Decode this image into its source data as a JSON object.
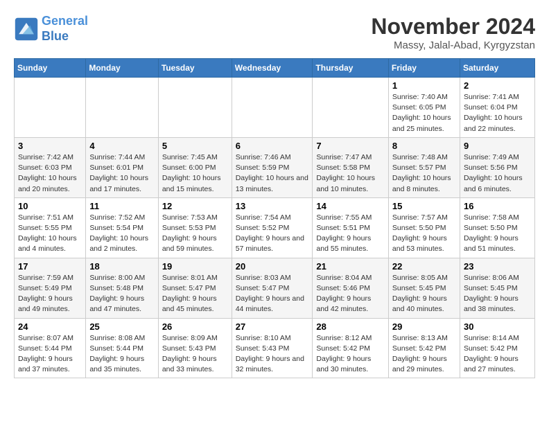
{
  "header": {
    "logo_line1": "General",
    "logo_line2": "Blue",
    "month": "November 2024",
    "location": "Massy, Jalal-Abad, Kyrgyzstan"
  },
  "weekdays": [
    "Sunday",
    "Monday",
    "Tuesday",
    "Wednesday",
    "Thursday",
    "Friday",
    "Saturday"
  ],
  "weeks": [
    [
      {
        "day": "",
        "info": ""
      },
      {
        "day": "",
        "info": ""
      },
      {
        "day": "",
        "info": ""
      },
      {
        "day": "",
        "info": ""
      },
      {
        "day": "",
        "info": ""
      },
      {
        "day": "1",
        "info": "Sunrise: 7:40 AM\nSunset: 6:05 PM\nDaylight: 10 hours and 25 minutes."
      },
      {
        "day": "2",
        "info": "Sunrise: 7:41 AM\nSunset: 6:04 PM\nDaylight: 10 hours and 22 minutes."
      }
    ],
    [
      {
        "day": "3",
        "info": "Sunrise: 7:42 AM\nSunset: 6:03 PM\nDaylight: 10 hours and 20 minutes."
      },
      {
        "day": "4",
        "info": "Sunrise: 7:44 AM\nSunset: 6:01 PM\nDaylight: 10 hours and 17 minutes."
      },
      {
        "day": "5",
        "info": "Sunrise: 7:45 AM\nSunset: 6:00 PM\nDaylight: 10 hours and 15 minutes."
      },
      {
        "day": "6",
        "info": "Sunrise: 7:46 AM\nSunset: 5:59 PM\nDaylight: 10 hours and 13 minutes."
      },
      {
        "day": "7",
        "info": "Sunrise: 7:47 AM\nSunset: 5:58 PM\nDaylight: 10 hours and 10 minutes."
      },
      {
        "day": "8",
        "info": "Sunrise: 7:48 AM\nSunset: 5:57 PM\nDaylight: 10 hours and 8 minutes."
      },
      {
        "day": "9",
        "info": "Sunrise: 7:49 AM\nSunset: 5:56 PM\nDaylight: 10 hours and 6 minutes."
      }
    ],
    [
      {
        "day": "10",
        "info": "Sunrise: 7:51 AM\nSunset: 5:55 PM\nDaylight: 10 hours and 4 minutes."
      },
      {
        "day": "11",
        "info": "Sunrise: 7:52 AM\nSunset: 5:54 PM\nDaylight: 10 hours and 2 minutes."
      },
      {
        "day": "12",
        "info": "Sunrise: 7:53 AM\nSunset: 5:53 PM\nDaylight: 9 hours and 59 minutes."
      },
      {
        "day": "13",
        "info": "Sunrise: 7:54 AM\nSunset: 5:52 PM\nDaylight: 9 hours and 57 minutes."
      },
      {
        "day": "14",
        "info": "Sunrise: 7:55 AM\nSunset: 5:51 PM\nDaylight: 9 hours and 55 minutes."
      },
      {
        "day": "15",
        "info": "Sunrise: 7:57 AM\nSunset: 5:50 PM\nDaylight: 9 hours and 53 minutes."
      },
      {
        "day": "16",
        "info": "Sunrise: 7:58 AM\nSunset: 5:50 PM\nDaylight: 9 hours and 51 minutes."
      }
    ],
    [
      {
        "day": "17",
        "info": "Sunrise: 7:59 AM\nSunset: 5:49 PM\nDaylight: 9 hours and 49 minutes."
      },
      {
        "day": "18",
        "info": "Sunrise: 8:00 AM\nSunset: 5:48 PM\nDaylight: 9 hours and 47 minutes."
      },
      {
        "day": "19",
        "info": "Sunrise: 8:01 AM\nSunset: 5:47 PM\nDaylight: 9 hours and 45 minutes."
      },
      {
        "day": "20",
        "info": "Sunrise: 8:03 AM\nSunset: 5:47 PM\nDaylight: 9 hours and 44 minutes."
      },
      {
        "day": "21",
        "info": "Sunrise: 8:04 AM\nSunset: 5:46 PM\nDaylight: 9 hours and 42 minutes."
      },
      {
        "day": "22",
        "info": "Sunrise: 8:05 AM\nSunset: 5:45 PM\nDaylight: 9 hours and 40 minutes."
      },
      {
        "day": "23",
        "info": "Sunrise: 8:06 AM\nSunset: 5:45 PM\nDaylight: 9 hours and 38 minutes."
      }
    ],
    [
      {
        "day": "24",
        "info": "Sunrise: 8:07 AM\nSunset: 5:44 PM\nDaylight: 9 hours and 37 minutes."
      },
      {
        "day": "25",
        "info": "Sunrise: 8:08 AM\nSunset: 5:44 PM\nDaylight: 9 hours and 35 minutes."
      },
      {
        "day": "26",
        "info": "Sunrise: 8:09 AM\nSunset: 5:43 PM\nDaylight: 9 hours and 33 minutes."
      },
      {
        "day": "27",
        "info": "Sunrise: 8:10 AM\nSunset: 5:43 PM\nDaylight: 9 hours and 32 minutes."
      },
      {
        "day": "28",
        "info": "Sunrise: 8:12 AM\nSunset: 5:42 PM\nDaylight: 9 hours and 30 minutes."
      },
      {
        "day": "29",
        "info": "Sunrise: 8:13 AM\nSunset: 5:42 PM\nDaylight: 9 hours and 29 minutes."
      },
      {
        "day": "30",
        "info": "Sunrise: 8:14 AM\nSunset: 5:42 PM\nDaylight: 9 hours and 27 minutes."
      }
    ]
  ]
}
